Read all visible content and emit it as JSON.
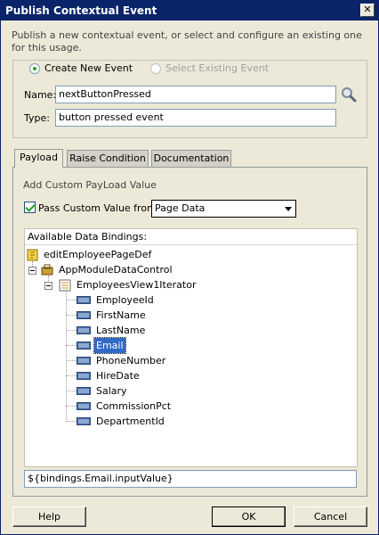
{
  "window": {
    "title": "Publish Contextual Event",
    "close_glyph": "✕"
  },
  "description": "Publish a new contextual event, or select and configure an existing one for this usage.",
  "event_mode": {
    "create_label": "Create New Event",
    "select_label": "Select Existing Event",
    "selected": "create"
  },
  "form": {
    "name_label": "Name:",
    "name_value": "nextButtonPressed",
    "type_label": "Type:",
    "type_value": "button pressed event"
  },
  "tabs": [
    {
      "label": "Payload",
      "active": true
    },
    {
      "label": "Raise Condition",
      "active": false
    },
    {
      "label": "Documentation",
      "active": false
    }
  ],
  "payload": {
    "heading": "Add Custom PayLoad Value",
    "pass_custom_label": "Pass Custom Value from:",
    "pass_custom_checked": true,
    "source_value": "Page Data",
    "bindings_header": "Available Data Bindings:",
    "tree": {
      "pagedef": "editEmployeePageDef",
      "datacontrol": "AppModuleDataControl",
      "iterator": "EmployeesView1Iterator",
      "attributes": [
        "EmployeeId",
        "FirstName",
        "LastName",
        "Email",
        "PhoneNumber",
        "HireDate",
        "Salary",
        "CommissionPct",
        "DepartmentId"
      ],
      "selected": "Email"
    },
    "expression": "${bindings.Email.inputValue}"
  },
  "buttons": {
    "help": "Help",
    "ok": "OK",
    "cancel": "Cancel"
  },
  "colors": {
    "title_bar": "#0a246a",
    "selection": "#316ac5",
    "dialog_bg": "#ece9d8"
  }
}
